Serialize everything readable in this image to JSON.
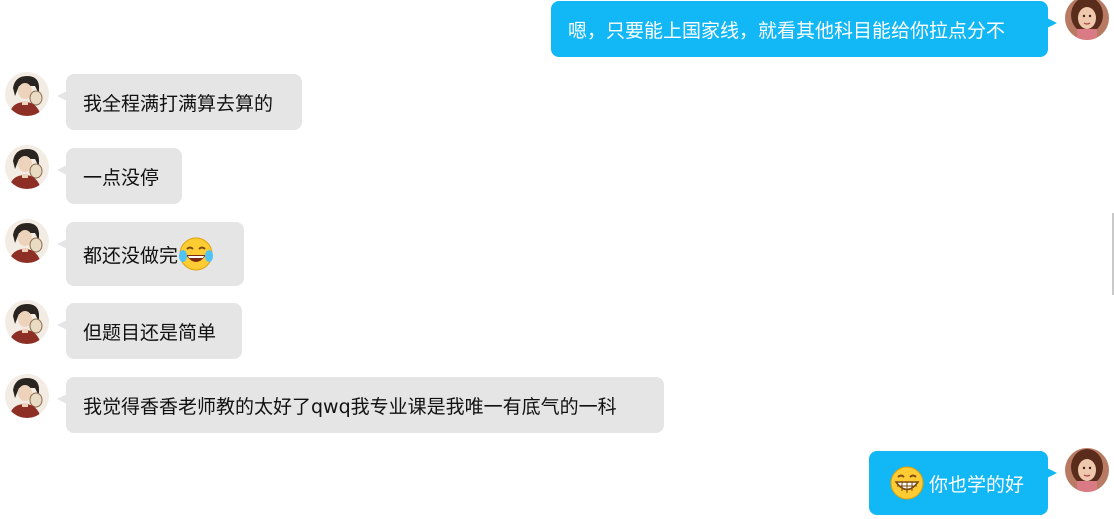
{
  "messages": [
    {
      "side": "out",
      "text": "嗯，只要能上国家线，就看其他科目能给你拉点分不"
    },
    {
      "side": "in",
      "text": "我全程满打满算去算的"
    },
    {
      "side": "in",
      "text": "一点没停"
    },
    {
      "side": "in",
      "text": "都还没做完",
      "emoji": "laughing-tears-emoji"
    },
    {
      "side": "in",
      "text": "但题目还是简单"
    },
    {
      "side": "in",
      "text": "我觉得香香老师教的太好了qwq我专业课是我唯一有底气的一科"
    },
    {
      "side": "out",
      "text": "你也学的好",
      "emoji": "grinning-emoji",
      "emoji_position": "before"
    }
  ],
  "colors": {
    "outgoing_bubble": "#12b7f5",
    "incoming_bubble": "#e5e5e5",
    "background": "#ffffff"
  }
}
